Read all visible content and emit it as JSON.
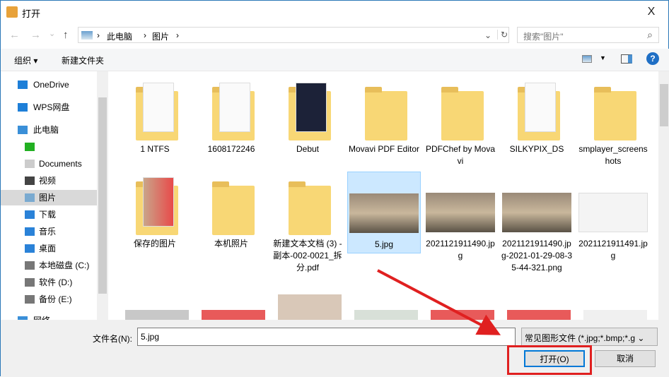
{
  "window": {
    "title": "打开",
    "close": "X"
  },
  "nav": {
    "back": "←",
    "forward": "→",
    "recent": "⌄",
    "up": "↑"
  },
  "address": {
    "crumbs": [
      "此电脑",
      "图片"
    ],
    "sep": "›",
    "dropdown": "⌄",
    "refresh": "↻"
  },
  "search": {
    "placeholder": "搜索\"图片\"",
    "icon": "⌕"
  },
  "toolbar": {
    "organize": "组织 ▾",
    "new_folder": "新建文件夹",
    "help": "?"
  },
  "sidebar": [
    {
      "label": "OneDrive",
      "icon": "cloud-icon",
      "top": true
    },
    {
      "label": "WPS网盘",
      "icon": "cloud-icon",
      "top": true
    },
    {
      "label": "此电脑",
      "icon": "computer-icon",
      "top": true
    },
    {
      "label": "",
      "icon": "app-icon"
    },
    {
      "label": "Documents",
      "icon": "document-icon"
    },
    {
      "label": "视频",
      "icon": "video-icon"
    },
    {
      "label": "图片",
      "icon": "picture-icon",
      "selected": true
    },
    {
      "label": "下载",
      "icon": "download-icon"
    },
    {
      "label": "音乐",
      "icon": "music-icon"
    },
    {
      "label": "桌面",
      "icon": "desktop-icon"
    },
    {
      "label": "本地磁盘 (C:)",
      "icon": "drive-icon"
    },
    {
      "label": "软件 (D:)",
      "icon": "drive-icon"
    },
    {
      "label": "备份 (E:)",
      "icon": "drive-icon"
    },
    {
      "label": "网络",
      "icon": "network-icon",
      "top": true
    }
  ],
  "files": [
    {
      "name": "1 NTFS",
      "type": "folder-docs"
    },
    {
      "name": "1608172246",
      "type": "folder-paper"
    },
    {
      "name": "Debut",
      "type": "folder-dark"
    },
    {
      "name": "Movavi PDF Editor",
      "type": "folder"
    },
    {
      "name": "PDFChef by Movavi",
      "type": "folder"
    },
    {
      "name": "SILKYPIX_DS",
      "type": "folder-paper"
    },
    {
      "name": "smplayer_screenshots",
      "type": "folder"
    },
    {
      "name": "保存的图片",
      "type": "folder-photo"
    },
    {
      "name": "本机照片",
      "type": "folder"
    },
    {
      "name": "新建文本文档 (3) - 副本-002-0021_拆分.pdf",
      "type": "folder"
    },
    {
      "name": "5.jpg",
      "type": "photo",
      "selected": true
    },
    {
      "name": "2021121911490.jpg",
      "type": "photo"
    },
    {
      "name": "2021121911490.jpg-2021-01-29-08-35-44-321.png",
      "type": "photo"
    },
    {
      "name": "2021121911491.jpg",
      "type": "doc"
    }
  ],
  "footer": {
    "filename_label": "文件名(N):",
    "filename_value": "5.jpg",
    "filetype": "常见图形文件 (*.jpg;*.bmp;*.g ⌄",
    "open": "打开(O)",
    "cancel": "取消"
  },
  "colors": {
    "accent": "#0078d7",
    "annotation": "#e02020",
    "folder": "#f8d775"
  }
}
